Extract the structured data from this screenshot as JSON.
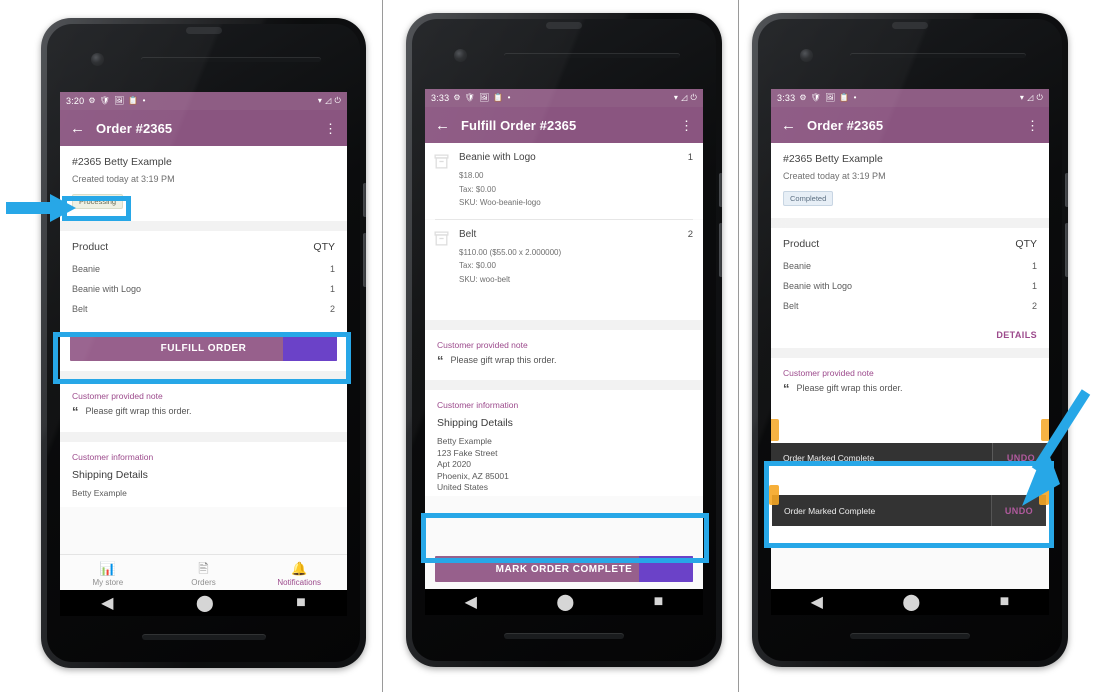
{
  "meta": {
    "accent_purple": "#8a5580",
    "highlight_blue": "#27a7e7",
    "ripple_purple": "#6b42c8"
  },
  "panels": [
    {
      "id": "panel-order-processing",
      "status_bar": {
        "time": "3:20",
        "left_icons": [
          "gear-icon",
          "shield-icon",
          "image-icon",
          "clipboard-icon",
          "dot-icon"
        ],
        "right_icons": [
          "wifi-icon",
          "signal-icon",
          "battery-icon"
        ]
      },
      "app_bar": {
        "back": "←",
        "title": "Order #2365",
        "overflow": "⋮"
      },
      "order": {
        "title": "#2365 Betty Example",
        "created": "Created today at 3:19 PM",
        "status_badge": "Processing"
      },
      "products": {
        "header_product": "Product",
        "header_qty": "QTY",
        "rows": [
          {
            "name": "Beanie",
            "qty": "1"
          },
          {
            "name": "Beanie with Logo",
            "qty": "1"
          },
          {
            "name": "Belt",
            "qty": "2"
          }
        ]
      },
      "primary_button": "FULFILL ORDER",
      "note": {
        "label": "Customer provided note",
        "text": "Please gift wrap this order."
      },
      "customer": {
        "label": "Customer information",
        "shipping_heading": "Shipping Details",
        "address_line1": "Betty Example"
      },
      "bottom_nav": [
        {
          "icon": "bar-chart-icon",
          "label": "My store",
          "active": false
        },
        {
          "icon": "document-icon",
          "label": "Orders",
          "active": false
        },
        {
          "icon": "bell-icon",
          "label": "Notifications",
          "active": true
        }
      ]
    },
    {
      "id": "panel-fulfill-order",
      "status_bar": {
        "time": "3:33",
        "left_icons": [
          "gear-icon",
          "shield-icon",
          "image-icon",
          "clipboard-icon",
          "dot-icon"
        ],
        "right_icons": [
          "wifi-icon",
          "signal-icon",
          "battery-icon"
        ]
      },
      "app_bar": {
        "back": "←",
        "title": "Fulfill Order #2365",
        "overflow": "⋮"
      },
      "items": [
        {
          "icon": "package-box-icon",
          "name": "Beanie with Logo",
          "qty": "1",
          "price": "$18.00",
          "tax": "Tax: $0.00",
          "sku": "SKU: Woo-beanie-logo"
        },
        {
          "icon": "package-box-icon",
          "name": "Belt",
          "qty": "2",
          "price": "$110.00 ($55.00 x 2.000000)",
          "tax": "Tax: $0.00",
          "sku": "SKU: woo-belt"
        }
      ],
      "note": {
        "label": "Customer provided note",
        "text": "Please gift wrap this order."
      },
      "customer": {
        "label": "Customer information",
        "shipping_heading": "Shipping Details",
        "address": "Betty Example\n123 Fake Street\nApt 2020\nPhoenix, AZ 85001\nUnited States"
      },
      "primary_button": "MARK ORDER COMPLETE"
    },
    {
      "id": "panel-order-completed",
      "status_bar": {
        "time": "3:33",
        "left_icons": [
          "gear-icon",
          "shield-icon",
          "image-icon",
          "clipboard-icon",
          "dot-icon"
        ],
        "right_icons": [
          "wifi-icon",
          "signal-icon",
          "battery-icon"
        ]
      },
      "app_bar": {
        "back": "←",
        "title": "Order #2365",
        "overflow": "⋮"
      },
      "order": {
        "title": "#2365 Betty Example",
        "created": "Created today at 3:19 PM",
        "status_badge": "Completed"
      },
      "products": {
        "header_product": "Product",
        "header_qty": "QTY",
        "rows": [
          {
            "name": "Beanie",
            "qty": "1"
          },
          {
            "name": "Beanie with Logo",
            "qty": "1"
          },
          {
            "name": "Belt",
            "qty": "2"
          }
        ],
        "details_link": "DETAILS"
      },
      "note": {
        "label": "Customer provided note",
        "text": "Please gift wrap this order."
      },
      "snackbar": {
        "message": "Order Marked Complete",
        "action": "UNDO"
      }
    }
  ],
  "android_nav": {
    "back": "back-triangle-icon",
    "home": "home-circle-icon",
    "recents": "recents-square-icon"
  }
}
